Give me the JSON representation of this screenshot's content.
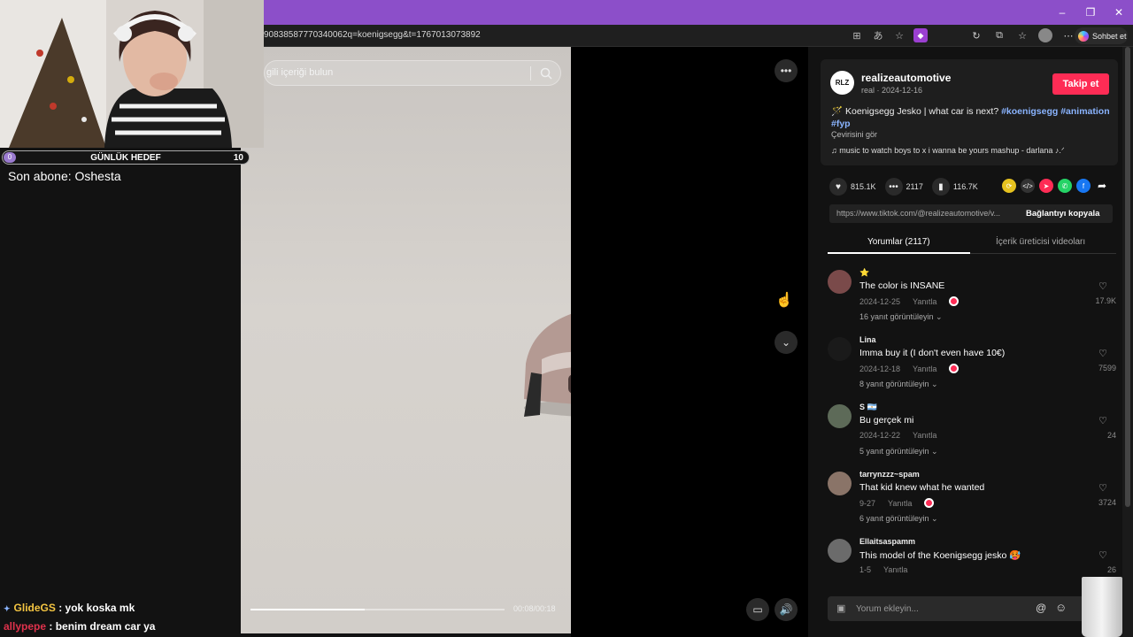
{
  "browser": {
    "url": "90838587770340062q=koenigsegg&t=1767013073892",
    "copilot_label": "Sohbet et",
    "win_controls": [
      "–",
      "❐",
      "✕"
    ]
  },
  "search": {
    "placeholder": "gili içeriği bulun"
  },
  "video": {
    "timecode": "00:08/00:18",
    "progress": 0.45
  },
  "post": {
    "avatar_text": "RLZ",
    "author": "realizeautomotive",
    "meta": "real · 2024-12-16",
    "follow_label": "Takip et",
    "caption_text": "Koenigsegg Jesko | what car is next?",
    "tags": [
      "#koenigsegg",
      "#animation",
      "#fyp"
    ],
    "translate": "Çevirisini gör",
    "music": "music to watch boys to x i wanna be yours mashup - darlana ♪.ᐟ"
  },
  "stats": {
    "likes": "815.1K",
    "comments": "2117",
    "saves": "116.7K"
  },
  "share": {
    "link": "https://www.tiktok.com/@realizeautomotive/v...",
    "copy_label": "Bağlantıyı kopyala"
  },
  "tabs": {
    "comments": "Yorumlar (2117)",
    "creator": "İçerik üreticisi videoları"
  },
  "comments": [
    {
      "user": "⭐",
      "text": "The color is INSANE",
      "date": "2024-12-25",
      "reply": "Yanıtla",
      "replies": "16 yanıt görüntüleyin ⌄",
      "likes": "17.9K",
      "creator_liked": true,
      "avatar_color": "#7a4a4a"
    },
    {
      "user": "Lina",
      "text": "Imma buy it (I don't even have 10€)",
      "date": "2024-12-18",
      "reply": "Yanıtla",
      "replies": "8 yanıt görüntüleyin ⌄",
      "likes": "7599",
      "creator_liked": true,
      "avatar_color": "#1a1a1a"
    },
    {
      "user": "S 🇦🇷",
      "text": "Bu gerçek mi",
      "date": "2024-12-22",
      "reply": "Yanıtla",
      "replies": "5 yanıt görüntüleyin ⌄",
      "likes": "24",
      "creator_liked": false,
      "avatar_color": "#5d6a58"
    },
    {
      "user": "tarrynzzz~spam",
      "text": "That kid knew what he wanted",
      "date": "9-27",
      "reply": "Yanıtla",
      "replies": "6 yanıt görüntüleyin ⌄",
      "likes": "3724",
      "creator_liked": true,
      "avatar_color": "#8a7468"
    },
    {
      "user": "Ellaitsaspamm",
      "text": "This model of the Koenigsegg jesko 🥵",
      "date": "1-5",
      "reply": "Yanıtla",
      "replies": "",
      "likes": "26",
      "creator_liked": false,
      "avatar_color": "#6b6b6b"
    }
  ],
  "comment_input": {
    "placeholder": "Yorum ekleyin..."
  },
  "stream": {
    "goal_title": "GÜNLÜK HEDEF",
    "goal_current": "0",
    "goal_target": "10",
    "last_sub": "Son abone: Oshesta",
    "chat": [
      {
        "user": "GlideGS",
        "message": " : yok koska mk"
      },
      {
        "user": "allypepe",
        "message": " : benim dream car ya"
      }
    ]
  },
  "colors": {
    "titlebar": "#8c4fc9",
    "accent": "#fe2c55",
    "tag": "#8ab4ff"
  }
}
